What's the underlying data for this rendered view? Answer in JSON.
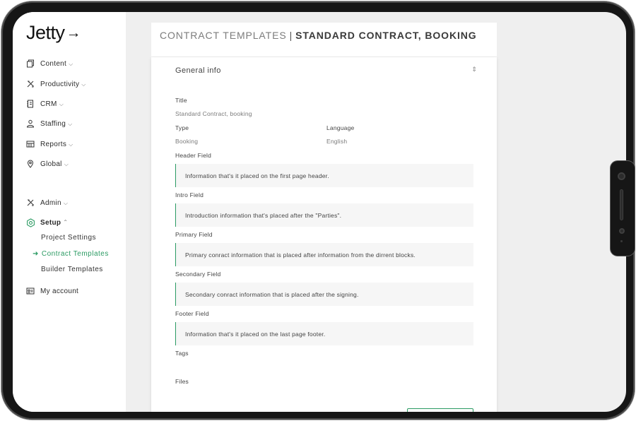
{
  "app": {
    "logo_text": "Jetty",
    "logo_arrow": "→"
  },
  "sidebar": {
    "items": [
      {
        "label": "Content",
        "icon": "copy-icon"
      },
      {
        "label": "Productivity",
        "icon": "tools-icon"
      },
      {
        "label": "CRM",
        "icon": "contacts-icon"
      },
      {
        "label": "Staffing",
        "icon": "people-icon"
      },
      {
        "label": "Reports",
        "icon": "reports-icon"
      },
      {
        "label": "Global",
        "icon": "globe-pin-icon"
      },
      {
        "label": "Admin",
        "icon": "admin-tools-icon"
      },
      {
        "label": "Setup",
        "icon": "gear-hex-icon"
      }
    ],
    "chevron_down": "⌵",
    "chevron_up": "⌃",
    "setup_sub": [
      "Project Settings",
      "Contract Templates",
      "Builder Templates"
    ],
    "current_arrow": "➜",
    "account": {
      "label": "My account",
      "icon": "id-card-icon"
    }
  },
  "header": {
    "section": "CONTRACT TEMPLATES",
    "separator": "|",
    "page": "STANDARD CONTRACT, BOOKING"
  },
  "card": {
    "title": "General info",
    "collapse_glyph": "⇕",
    "fields": {
      "title_label": "Title",
      "title_value": "Standard Contract, booking",
      "type_label": "Type",
      "type_value": "Booking",
      "language_label": "Language",
      "language_value": "English",
      "header_label": "Header Field",
      "header_value": "Information that's it placed on the first page header.",
      "intro_label": "Intro Field",
      "intro_value": "Introduction information that's placed after the \"Parties\".",
      "primary_label": "Primary Field",
      "primary_value": "Primary conract information that is placed after  information from the dirrent blocks.",
      "secondary_label": "Secondary Field",
      "secondary_value": "Secondary conract information that is placed after the signing.",
      "footer_label": "Footer Field",
      "footer_value": "Information that's it placed on the last page footer.",
      "tags_label": "Tags",
      "files_label": "Files"
    }
  },
  "colors": {
    "accent": "#2a9a62",
    "frame": "#161616",
    "canvas": "#efefef"
  }
}
